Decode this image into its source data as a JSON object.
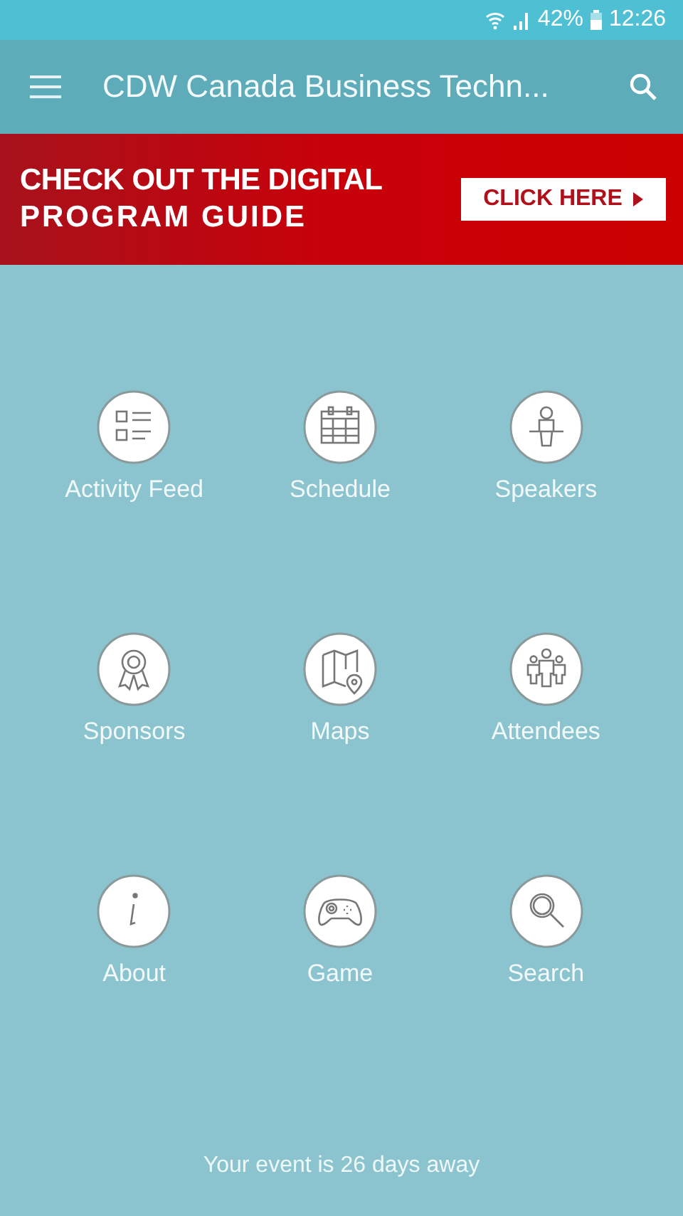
{
  "status_bar": {
    "battery": "42%",
    "time": "12:26"
  },
  "app_bar": {
    "title": "CDW Canada Business Techn..."
  },
  "banner": {
    "line_1": "CHECK OUT THE DIGITAL",
    "line_2": "PROGRAM GUIDE",
    "button": "CLICK HERE"
  },
  "tiles": [
    {
      "label": "Activity Feed",
      "kind": "feed"
    },
    {
      "label": "Schedule",
      "kind": "calendar"
    },
    {
      "label": "Speakers",
      "kind": "speaker"
    },
    {
      "label": "Sponsors",
      "kind": "ribbon"
    },
    {
      "label": "Maps",
      "kind": "map"
    },
    {
      "label": "Attendees",
      "kind": "people"
    },
    {
      "label": "About",
      "kind": "info"
    },
    {
      "label": "Game",
      "kind": "gamepad"
    },
    {
      "label": "Search",
      "kind": "search"
    }
  ],
  "footer": "Your event is 26 days away"
}
